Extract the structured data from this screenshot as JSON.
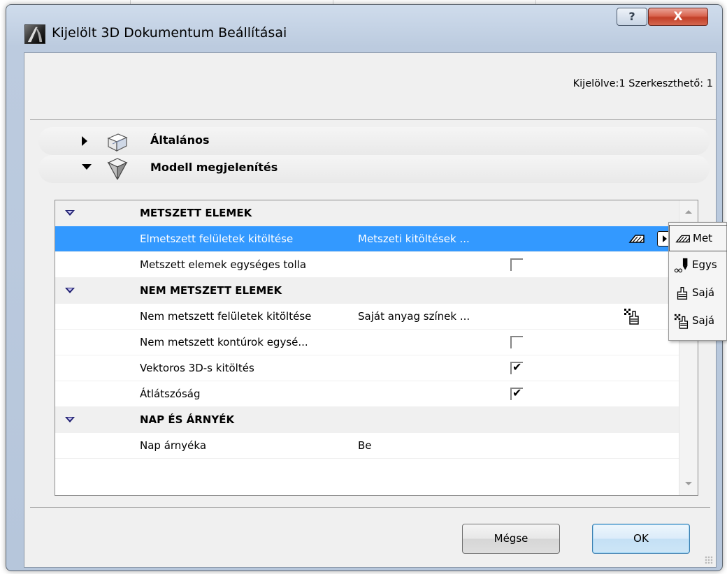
{
  "window": {
    "title": "Kijelölt 3D Dokumentum Beállításai",
    "help_label": "?",
    "close_label": "X"
  },
  "header": {
    "selected_info": "Kijelölve:1 Szerkeszthető: 1"
  },
  "sections": [
    {
      "label": "Általános",
      "expanded": false,
      "icon": "general-panel-icon"
    },
    {
      "label": "Modell megjelenítés",
      "expanded": true,
      "icon": "model-display-icon"
    }
  ],
  "table": {
    "groups": [
      {
        "label": "METSZETT ELEMEK",
        "rows": [
          {
            "name": "Elmetszett felületek kitöltése",
            "value": "Metszeti kitöltések ...",
            "icon": "cut-fill-icon",
            "selected": true
          },
          {
            "name": "Metszett elemek egységes tolla",
            "checkbox": false
          }
        ]
      },
      {
        "label": "NEM METSZETT ELEMEK",
        "rows": [
          {
            "name": "Nem metszett felületek kitöltése",
            "value": "Saját anyag színek ...",
            "icon": "own-material-shaded-icon"
          },
          {
            "name": "Nem metszett kontúrok egysé...",
            "checkbox": false
          },
          {
            "name": "Vektoros 3D-s kitöltés",
            "checkbox": true
          },
          {
            "name": "Átlátszóság",
            "checkbox": true
          }
        ]
      },
      {
        "label": "NAP ÉS ÁRNYÉK",
        "rows": [
          {
            "name": "Nap árnyéka",
            "value": "Be"
          }
        ]
      }
    ],
    "check_glyph": "✔"
  },
  "popup": {
    "items": [
      {
        "label": "Met",
        "icon": "cut-fill-icon",
        "selected": true
      },
      {
        "label": "Egys",
        "icon": "uniform-pen-icon"
      },
      {
        "label": "Sajá",
        "icon": "own-material-icon"
      },
      {
        "label": "Sajá",
        "icon": "own-material-shaded-icon"
      }
    ]
  },
  "buttons": {
    "cancel_label": "Mégse",
    "ok_label": "OK"
  },
  "colors": {
    "selection": "#3399ff",
    "frame": "#bccbdf",
    "close": "#c74c34"
  }
}
